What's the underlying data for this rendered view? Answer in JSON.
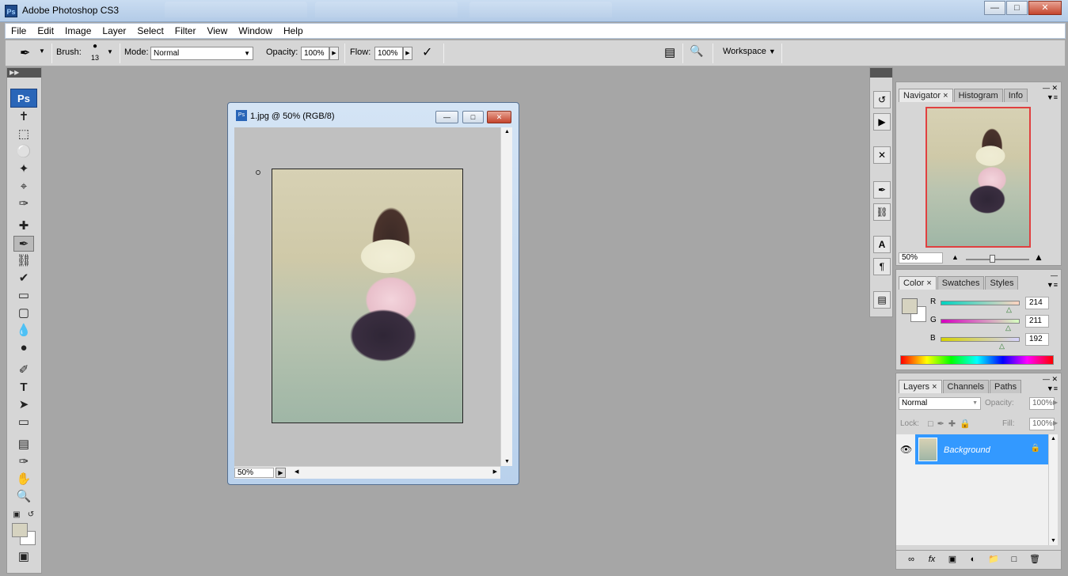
{
  "app": {
    "title": "Adobe Photoshop CS3",
    "ps_badge": "Ps"
  },
  "menu": [
    "File",
    "Edit",
    "Image",
    "Layer",
    "Select",
    "Filter",
    "View",
    "Window",
    "Help"
  ],
  "options": {
    "brush_label": "Brush:",
    "brush_size": "13",
    "mode_label": "Mode:",
    "mode_value": "Normal",
    "opacity_label": "Opacity:",
    "opacity_value": "100%",
    "flow_label": "Flow:",
    "flow_value": "100%",
    "workspace_label": "Workspace"
  },
  "document": {
    "title": "1.jpg @ 50% (RGB/8)",
    "zoom": "50%"
  },
  "navigator": {
    "tabs": [
      "Navigator",
      "Histogram",
      "Info"
    ],
    "zoom": "50%"
  },
  "color": {
    "tabs": [
      "Color",
      "Swatches",
      "Styles"
    ],
    "r_label": "R",
    "r_value": "214",
    "g_label": "G",
    "g_value": "211",
    "b_label": "B",
    "b_value": "192",
    "foreground": "#d6d3c0"
  },
  "layers": {
    "tabs": [
      "Layers",
      "Channels",
      "Paths"
    ],
    "blend_mode": "Normal",
    "opacity_label": "Opacity:",
    "opacity_value": "100%",
    "lock_label": "Lock:",
    "fill_label": "Fill:",
    "fill_value": "100%",
    "layer_name": "Background"
  }
}
